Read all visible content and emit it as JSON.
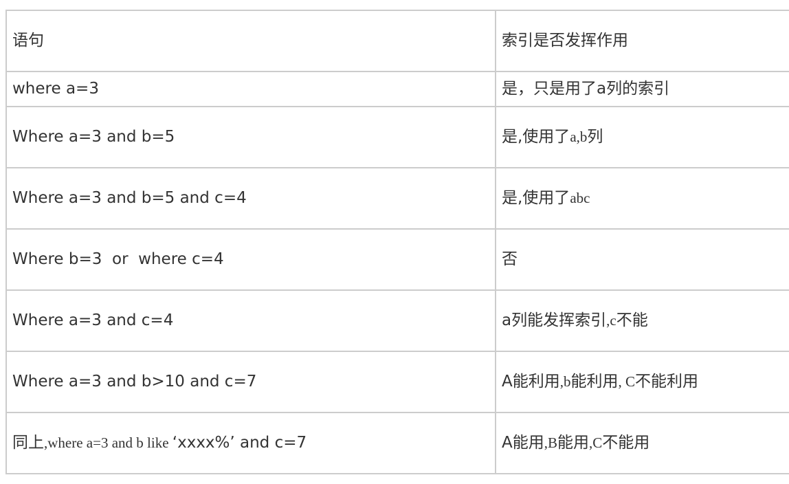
{
  "table": {
    "header": {
      "statement": "语句",
      "index_effect": "索引是否发挥作用"
    },
    "rows": [
      {
        "statement": "where a=3",
        "effect": "是，只是用了a列的索引"
      },
      {
        "statement": "Where a=3 and b=5",
        "effect_prefix": "是,使用了",
        "effect_serif": "a,b",
        "effect_suffix": "列"
      },
      {
        "statement": "Where a=3 and b=5 and c=4",
        "effect_prefix": "是,使用了",
        "effect_serif": "abc"
      },
      {
        "statement": "Where b=3  or  where c=4",
        "effect": "否"
      },
      {
        "statement": "Where a=3 and c=4",
        "effect_prefix": "a列能发挥索引",
        "effect_serif": ",c",
        "effect_suffix": "不能"
      },
      {
        "statement": "Where a=3 and b>10 and c=7",
        "effect_prefix": "A能利用",
        "effect_serif": ",b",
        "effect_mid": "能利用",
        "effect_serif2": ", C",
        "effect_suffix": "不能利用"
      },
      {
        "statement_prefix": "同上",
        "statement_serif": ",where a=3 and b like ",
        "statement_suffix": "‘xxxx%’ and c=7",
        "effect_prefix": "A能用",
        "effect_serif": ",B",
        "effect_mid": "能用",
        "effect_serif2": ",C",
        "effect_suffix": "不能用"
      }
    ]
  }
}
